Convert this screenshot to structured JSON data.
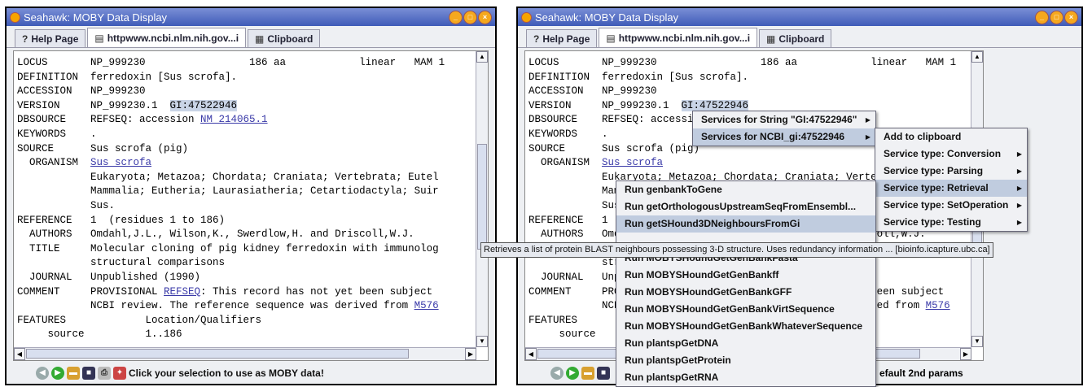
{
  "window_title": "Seahawk: MOBY Data Display",
  "tabs": [
    {
      "label": "Help Page",
      "icon": "help-icon"
    },
    {
      "label": "httpwww.ncbi.nlm.nih.gov...i",
      "icon": "document-icon"
    },
    {
      "label": "Clipboard",
      "icon": "clipboard-icon"
    }
  ],
  "record_lines": [
    "LOCUS       NP_999230                 186 aa            linear   MAM 1",
    "DEFINITION  ferredoxin [Sus scrofa].",
    "ACCESSION   NP_999230",
    "VERSION     NP_999230.1  GI:47522946",
    "DBSOURCE    REFSEQ: accession NM_214065.1",
    "KEYWORDS    .",
    "SOURCE      Sus scrofa (pig)",
    "  ORGANISM  Sus scrofa",
    "            Eukaryota; Metazoa; Chordata; Craniata; Vertebrata; Eutel",
    "            Mammalia; Eutheria; Laurasiatheria; Cetartiodactyla; Suir",
    "            Sus.",
    "REFERENCE   1  (residues 1 to 186)",
    "  AUTHORS   Omdahl,J.L., Wilson,K., Swerdlow,H. and Driscoll,W.J.",
    "  TITLE     Molecular cloning of pig kidney ferredoxin with immunolog",
    "            structural comparisons",
    "  JOURNAL   Unpublished (1990)",
    "COMMENT     PROVISIONAL REFSEQ: This record has not yet been subject",
    "            NCBI review. The reference sequence was derived from M576",
    "FEATURES             Location/Qualifiers",
    "     source          1..186"
  ],
  "links": {
    "gi": "GI:47522946",
    "nm": "NM_214065.1",
    "organism": "Sus scrofa",
    "refseq": "REFSEQ",
    "m576": "M576"
  },
  "status_text_a": "Click your selection to use as MOBY data!",
  "status_text_b": "efault 2nd params",
  "context_menu": [
    {
      "label": "Services for String \"GI:47522946\"",
      "has_submenu": true
    },
    {
      "label": "Services for NCBI_gi:47522946",
      "has_submenu": true,
      "selected": true
    }
  ],
  "submenu": [
    {
      "label": "Add to clipboard",
      "has_submenu": false
    },
    {
      "label": "Service type: Conversion",
      "has_submenu": true
    },
    {
      "label": "Service type: Parsing",
      "has_submenu": true
    },
    {
      "label": "Service type: Retrieval",
      "has_submenu": true,
      "selected": true
    },
    {
      "label": "Service type: SetOperation",
      "has_submenu": true
    },
    {
      "label": "Service type: Testing",
      "has_submenu": true
    }
  ],
  "retrieval_services": [
    {
      "label": "Run genbankToGene"
    },
    {
      "label": "Run getOrthologousUpstreamSeqFromEnsembl..."
    },
    {
      "label": "Run getSHound3DNeighboursFromGi",
      "selected": true
    },
    {
      "label": ""
    },
    {
      "label": "Run MOBYSHoundGetGenBankFasta"
    },
    {
      "label": "Run MOBYSHoundGetGenBankff"
    },
    {
      "label": "Run MOBYSHoundGetGenBankGFF"
    },
    {
      "label": "Run MOBYSHoundGetGenBankVirtSequence"
    },
    {
      "label": "Run MOBYSHoundGetGenBankWhateverSequence"
    },
    {
      "label": "Run plantspGetDNA"
    },
    {
      "label": "Run plantspGetProtein"
    },
    {
      "label": "Run plantspGetRNA"
    }
  ],
  "tooltip": "Retrieves a list of protein BLAST neighbours possessing 3-D structure. Uses redundancy information ... [bioinfo.icapture.ubc.ca]",
  "colors": {
    "title_bar": "#3f5bb8",
    "link": "#3a3aa8",
    "menu_selected": "#c0ccdf",
    "highlight": "#c9d4e6"
  }
}
